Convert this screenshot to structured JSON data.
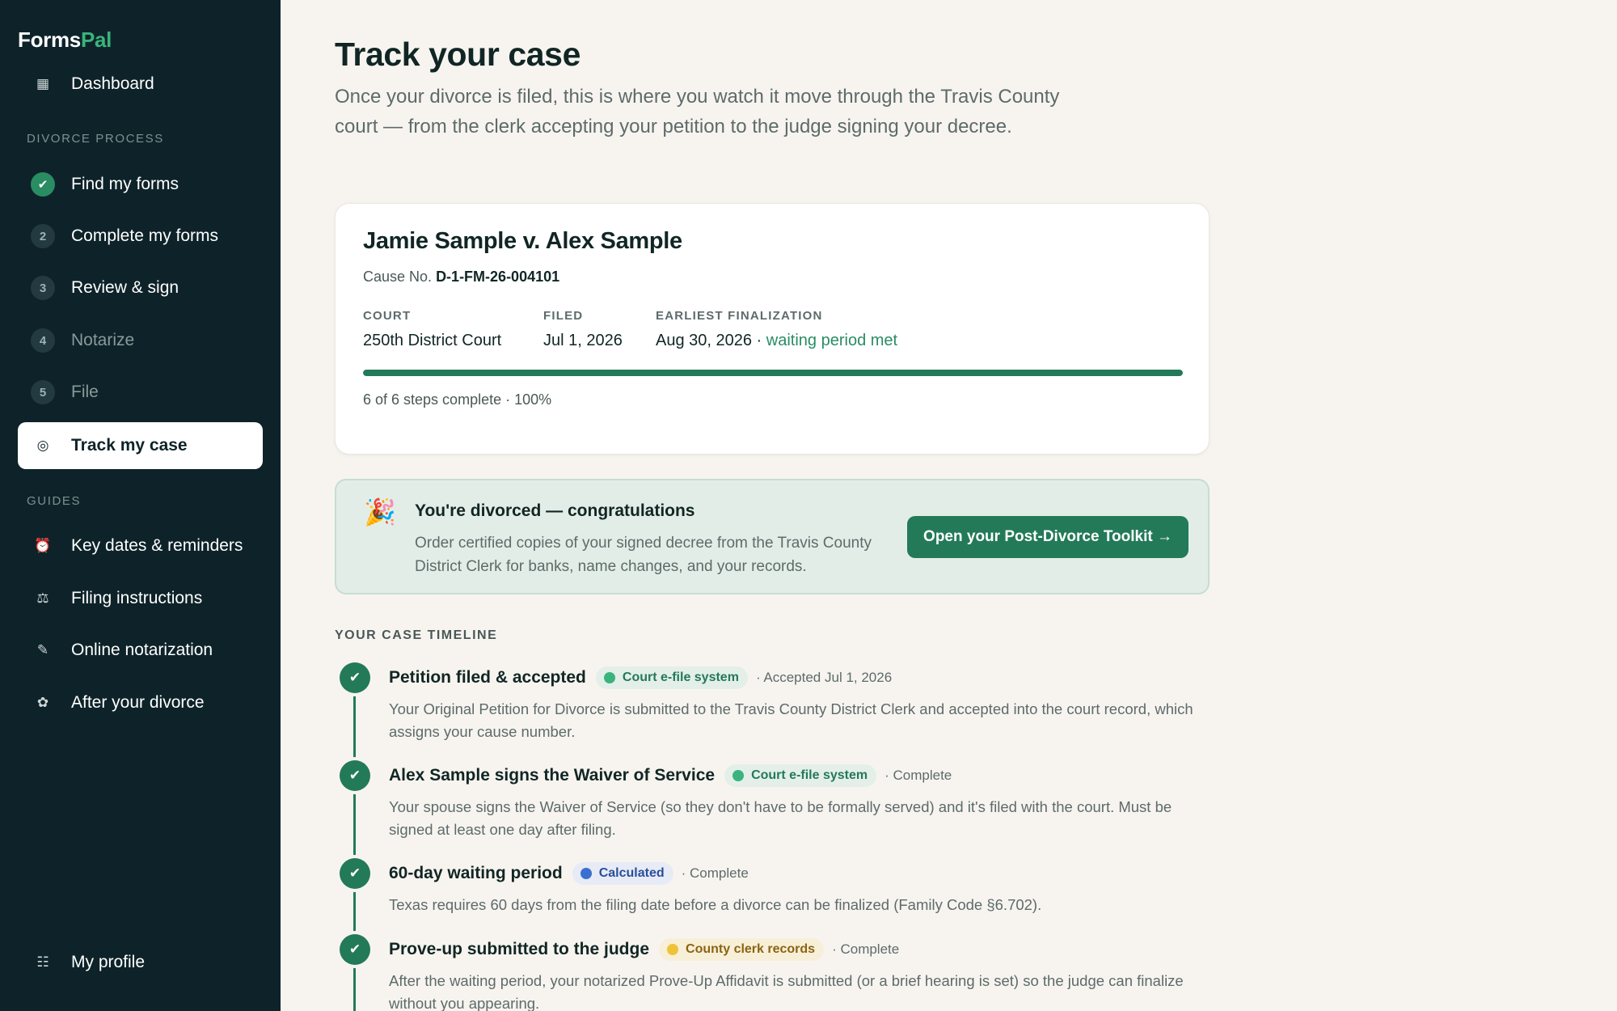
{
  "brand": {
    "name_part1": "Forms",
    "name_part2": "Pal",
    "accent": "#3bb37c"
  },
  "sidebar": {
    "dashboard": {
      "label": "Dashboard",
      "icon": "grid-icon"
    },
    "section_process": "DIVORCE PROCESS",
    "steps": [
      {
        "num": "",
        "label": "Find my forms",
        "state": "done"
      },
      {
        "num": "2",
        "label": "Complete my forms",
        "state": "available"
      },
      {
        "num": "3",
        "label": "Review & sign",
        "state": "available"
      },
      {
        "num": "4",
        "label": "Notarize",
        "state": "muted"
      },
      {
        "num": "5",
        "label": "File",
        "state": "muted"
      }
    ],
    "active": {
      "label": "Track my case",
      "icon": "target-icon"
    },
    "section_guides": "GUIDES",
    "guides": [
      {
        "label": "Key dates & reminders",
        "icon": "alarm-clock-icon"
      },
      {
        "label": "Filing instructions",
        "icon": "scales-icon"
      },
      {
        "label": "Online notarization",
        "icon": "pen-icon"
      },
      {
        "label": "After your divorce",
        "icon": "flower-icon"
      }
    ],
    "profile": {
      "label": "My profile",
      "icon": "list-icon"
    }
  },
  "main": {
    "title": "Track your case",
    "description": "Once your divorce is filed, this is where you watch it move through the Travis County court — from the clerk accepting your petition to the judge signing your decree."
  },
  "case": {
    "title": "Jamie Sample v. Alex Sample",
    "cause_label": "Cause No.",
    "cause_number": "D-1-FM-26-004101",
    "court_label": "COURT",
    "court_value": "250th District Court",
    "filed_label": "FILED",
    "filed_value": "Jul 1, 2026",
    "final_label": "EARLIEST FINALIZATION",
    "final_value": "Aug 30, 2026 ·",
    "final_note": "waiting period met",
    "progress_percent": 100,
    "progress_text": "6 of 6 steps complete · 100%"
  },
  "congrats": {
    "title": "You're divorced — congratulations",
    "description": "Order certified copies of your signed decree from the Travis County District Clerk for banks, name changes, and your records.",
    "button": "Open your Post-Divorce Toolkit →"
  },
  "timeline": {
    "heading": "YOUR CASE TIMELINE",
    "items": [
      {
        "title": "Petition filed & accepted",
        "badge": "Court e-file system",
        "badge_color": "green",
        "status": "· Accepted Jul 1, 2026",
        "desc": "Your Original Petition for Divorce is submitted to the Travis County District Clerk and accepted into the court record, which assigns your cause number."
      },
      {
        "title": "Alex Sample signs the Waiver of Service",
        "badge": "Court e-file system",
        "badge_color": "green",
        "status": "· Complete",
        "desc": "Your spouse signs the Waiver of Service (so they don't have to be formally served) and it's filed with the court. Must be signed at least one day after filing."
      },
      {
        "title": "60-day waiting period",
        "badge": "Calculated",
        "badge_color": "blue",
        "status": "· Complete",
        "desc": "Texas requires 60 days from the filing date before a divorce can be finalized (Family Code §6.702)."
      },
      {
        "title": "Prove-up submitted to the judge",
        "badge": "County clerk records",
        "badge_color": "yellow",
        "status": "· Complete",
        "desc": "After the waiting period, your notarized Prove-Up Affidavit is submitted (or a brief hearing is set) so the judge can finalize without you appearing."
      }
    ]
  }
}
